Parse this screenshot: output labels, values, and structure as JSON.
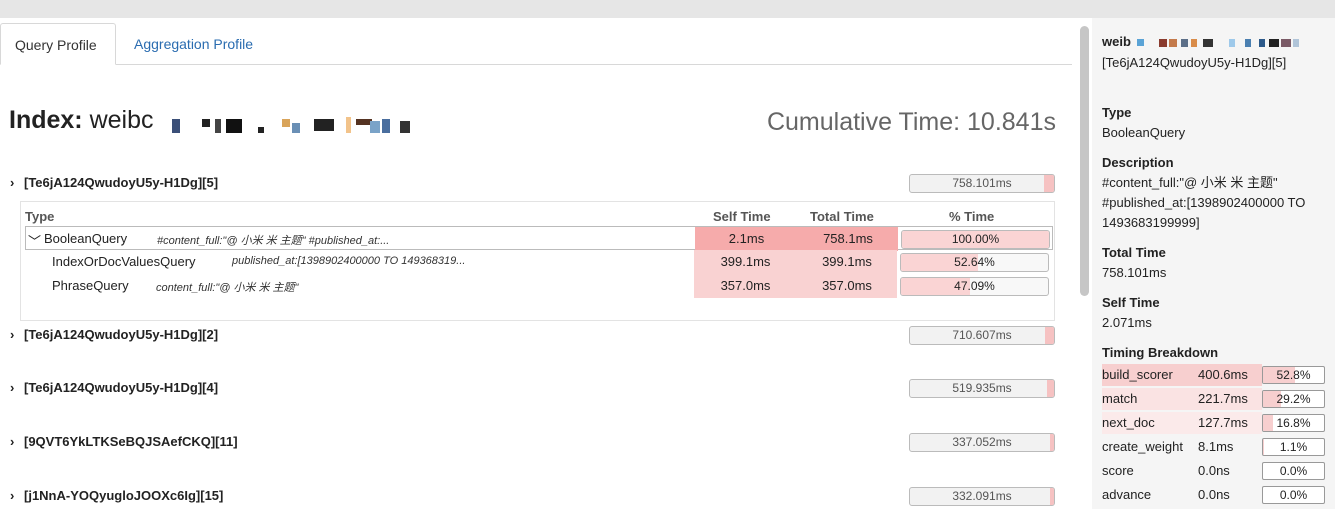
{
  "tabs": [
    {
      "label": "Query Profile",
      "active": true
    },
    {
      "label": "Aggregation Profile",
      "active": false
    }
  ],
  "index": {
    "label": "Index:",
    "name": "weibc"
  },
  "cumulative_time": "Cumulative Time: 10.841s",
  "shards": [
    {
      "id": "[Te6jA124QwudoyU5y-H1Dg][5]",
      "time": "758.101ms",
      "fraction": 0.07,
      "expanded": true
    },
    {
      "id": "[Te6jA124QwudoyU5y-H1Dg][2]",
      "time": "710.607ms",
      "fraction": 0.065,
      "expanded": false
    },
    {
      "id": "[Te6jA124QwudoyU5y-H1Dg][4]",
      "time": "519.935ms",
      "fraction": 0.05,
      "expanded": false
    },
    {
      "id": "[9QVT6YkLTKSeBQJSAefCKQ][11]",
      "time": "337.052ms",
      "fraction": 0.03,
      "expanded": false
    },
    {
      "id": "[j1NnA-YOQyugloJOOXc6Ig][15]",
      "time": "332.091ms",
      "fraction": 0.03,
      "expanded": false
    }
  ],
  "query_table": {
    "headers": {
      "type": "Type",
      "self": "Self Time",
      "total": "Total Time",
      "pct": "% Time"
    },
    "rows": [
      {
        "type": "BooleanQuery",
        "desc": "#content_full:\"@ 小米 米 主题\" #published_at:...",
        "self": "2.1ms",
        "total": "758.1ms",
        "pct": "100.00%",
        "pct_value": 100.0,
        "chevron": "﹀"
      },
      {
        "type": "IndexOrDocValuesQuery",
        "desc": "published_at:[1398902400000 TO 149368319...",
        "self": "399.1ms",
        "total": "399.1ms",
        "pct": "52.64%",
        "pct_value": 52.64
      },
      {
        "type": "PhraseQuery",
        "desc": "content_full:\"@ 小米 米 主题\"",
        "self": "357.0ms",
        "total": "357.0ms",
        "pct": "47.09%",
        "pct_value": 47.09
      }
    ]
  },
  "sidebar": {
    "title": "weib",
    "shard": "[Te6jA124QwudoyU5y-H1Dg][5]",
    "type_label": "Type",
    "type_value": "BooleanQuery",
    "desc_label": "Description",
    "desc_value_1": "#content_full:\"@ 小米 米 主题\"",
    "desc_value_2": "#published_at:[1398902400000 TO",
    "desc_value_3": "1493683199999]",
    "total_label": "Total Time",
    "total_value": "758.101ms",
    "self_label": "Self Time",
    "self_value": "2.071ms",
    "timing_label": "Timing Breakdown",
    "timing": [
      {
        "name": "build_scorer",
        "value": "400.6ms",
        "pct": "52.8%",
        "pct_value": 52.8
      },
      {
        "name": "match",
        "value": "221.7ms",
        "pct": "29.2%",
        "pct_value": 29.2
      },
      {
        "name": "next_doc",
        "value": "127.7ms",
        "pct": "16.8%",
        "pct_value": 16.8
      },
      {
        "name": "create_weight",
        "value": "8.1ms",
        "pct": "1.1%",
        "pct_value": 1.1
      },
      {
        "name": "score",
        "value": "0.0ns",
        "pct": "0.0%",
        "pct_value": 0.0
      },
      {
        "name": "advance",
        "value": "0.0ns",
        "pct": "0.0%",
        "pct_value": 0.0
      }
    ]
  },
  "colors": {
    "accent": "#2a6cb0",
    "bar_fill": "#f6c2c2",
    "self_cell": "#f7b7b7",
    "total_cell": "#f7b7b7"
  }
}
